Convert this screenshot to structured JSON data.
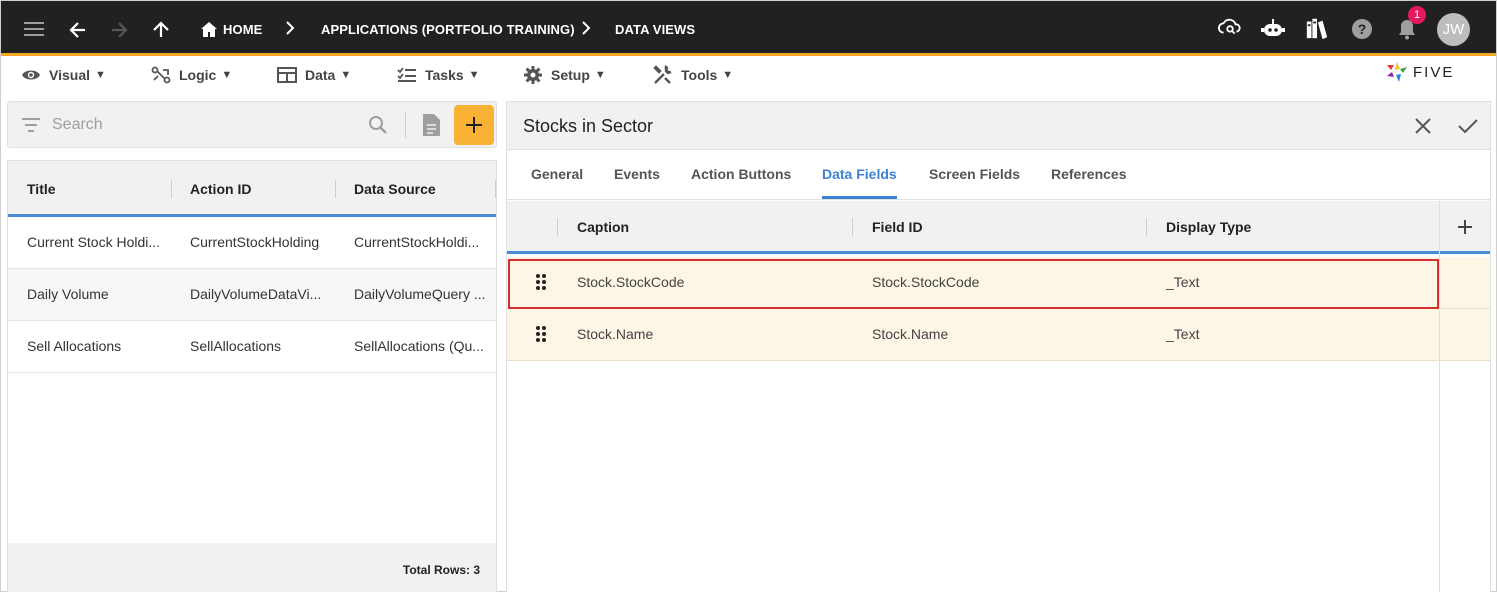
{
  "topbar": {
    "breadcrumbs": [
      "HOME",
      "APPLICATIONS (PORTFOLIO TRAINING)",
      "DATA VIEWS"
    ],
    "notification_count": "1",
    "avatar_initials": "JW",
    "icons": [
      "menu-icon",
      "back-icon",
      "forward-icon",
      "up-icon",
      "home-icon",
      "cloud-search-icon",
      "bot-icon",
      "library-icon",
      "help-icon",
      "bell-icon"
    ]
  },
  "menubar": {
    "items": [
      "Visual",
      "Logic",
      "Data",
      "Tasks",
      "Setup",
      "Tools"
    ],
    "logo_text": "FIVE"
  },
  "left": {
    "search_placeholder": "Search",
    "columns": [
      "Title",
      "Action ID",
      "Data Source"
    ],
    "rows": [
      [
        "Current Stock Holdi...",
        "CurrentStockHolding",
        "CurrentStockHoldi..."
      ],
      [
        "Daily Volume",
        "DailyVolumeDataVi...",
        "DailyVolumeQuery ..."
      ],
      [
        "Sell Allocations",
        "SellAllocations",
        "SellAllocations (Qu..."
      ]
    ],
    "total_rows": "Total Rows: 3"
  },
  "right": {
    "title": "Stocks in Sector",
    "tabs": [
      "General",
      "Events",
      "Action Buttons",
      "Data Fields",
      "Screen Fields",
      "References"
    ],
    "active_tab": "Data Fields",
    "columns": [
      "Caption",
      "Field ID",
      "Display Type"
    ],
    "rows": [
      [
        "Stock.StockCode",
        "Stock.StockCode",
        "_Text"
      ],
      [
        "Stock.Name",
        "Stock.Name",
        "_Text"
      ]
    ]
  },
  "colors": {
    "accent": "#f5a623",
    "add_button": "#f9b233",
    "active_tab": "#3d82d1",
    "selection": "#d32f2f",
    "row_highlight": "#fdf5e6"
  }
}
